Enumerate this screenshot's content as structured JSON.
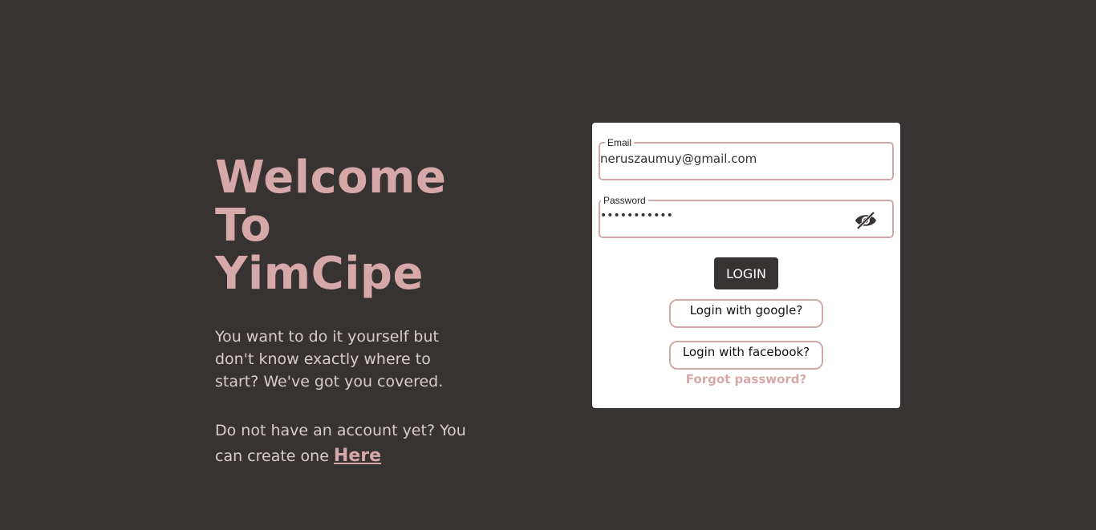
{
  "hero": {
    "title_line1": "Welcome",
    "title_line2": "To YimCipe",
    "description": "You want to do it yourself but don't know exactly where to start? We've got you covered.",
    "signup_text": "Do not have an account yet? You can create one ",
    "signup_link": "Here"
  },
  "form": {
    "email_label": "Email",
    "email_value": "neruszaumuy@gmail.com",
    "password_label": "Password",
    "password_value": "•••••••••••",
    "password_toggle_icon": "eye-off-icon",
    "login_label": "LOGIN",
    "google_label": "Login with google?",
    "facebook_label": "Login with facebook?",
    "forgot_label": "Forgot password?"
  },
  "colors": {
    "background": "#383333",
    "accent": "#d7a8a8",
    "card": "#ffffff",
    "border": "#d2a9a9"
  }
}
